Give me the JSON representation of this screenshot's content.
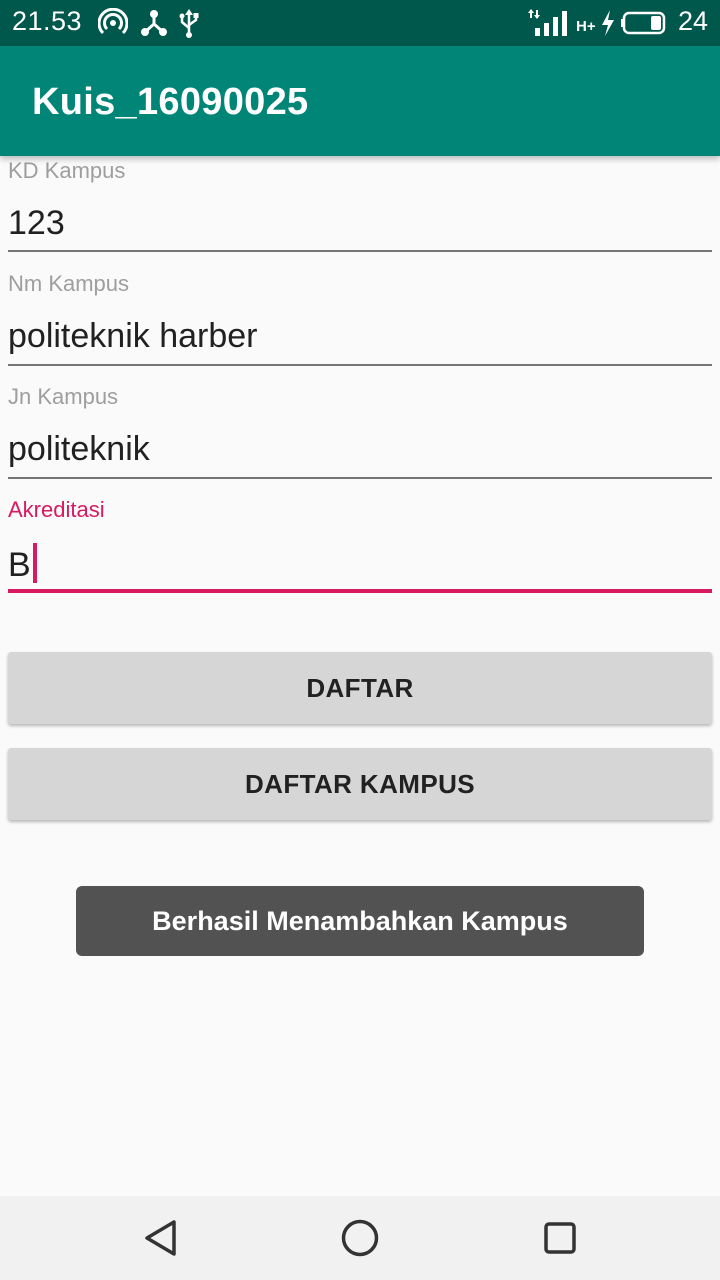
{
  "status_bar": {
    "time": "21.53",
    "network_type": "H+",
    "battery_level": "24",
    "icons": [
      "hotspot-icon",
      "share-icon",
      "usb-icon",
      "signal-icon",
      "charging-icon",
      "battery-icon"
    ]
  },
  "app_bar": {
    "title": "Kuis_16090025"
  },
  "form": {
    "kd_kampus": {
      "label": "KD Kampus",
      "value": "123"
    },
    "nm_kampus": {
      "label": "Nm Kampus",
      "value": "politeknik harber"
    },
    "jn_kampus": {
      "label": "Jn Kampus",
      "value": "politeknik"
    },
    "akreditasi": {
      "label": "Akreditasi",
      "value": "B",
      "focused": true
    }
  },
  "buttons": {
    "daftar": "DAFTAR",
    "daftar_kampus": "DAFTAR KAMPUS"
  },
  "toast": {
    "message": "Berhasil Menambahkan Kampus"
  },
  "colors": {
    "status_bar": "#00574b",
    "app_bar": "#008577",
    "accent": "#d81b60",
    "button": "#d6d6d6",
    "toast": "#525252"
  },
  "nav_bar": {
    "icons": [
      "back-icon",
      "home-icon",
      "recents-icon"
    ]
  }
}
